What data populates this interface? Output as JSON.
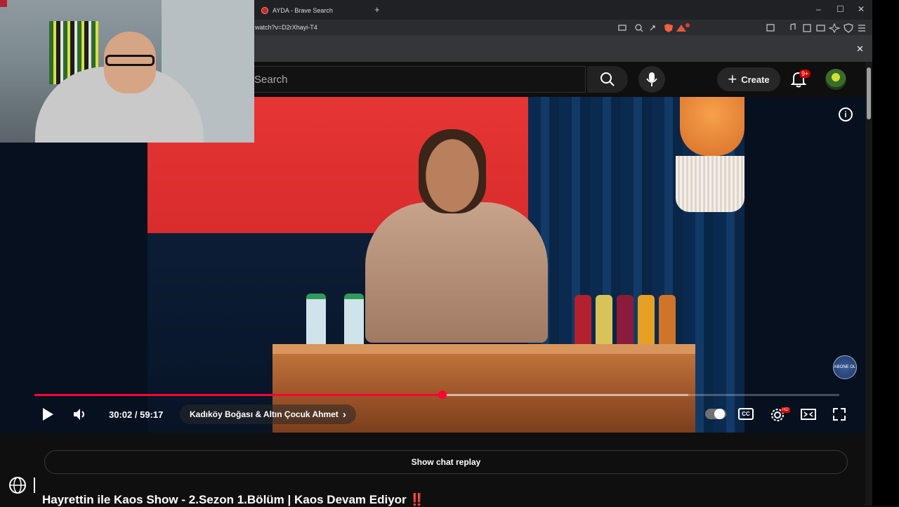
{
  "browser": {
    "tab_title": "AYDA - Brave Search",
    "new_tab_label": "+",
    "url": "watch?v=D2rXhayi-T4",
    "window_controls": [
      "–",
      "☐",
      "✕"
    ],
    "infobar_close": "✕"
  },
  "header": {
    "search_placeholder": "Search",
    "create_label": "Create",
    "notification_badge": "9+"
  },
  "video": {
    "info_icon": "i",
    "subscribe_badge": "ABONE OL"
  },
  "player": {
    "time": "30:02 / 59:17",
    "chapter_title": "Kadıköy Boğası & Altın Çocuk Ahmet",
    "chapter_chevron": "›",
    "cc_label": "CC",
    "hd_badge": "HD",
    "progress_fraction": 0.507
  },
  "below": {
    "show_chat_label": "Show chat replay",
    "video_title": "Hayrettin ile Kaos Show - 2.Sezon 1.Bölüm | Kaos Devam Ediyor ‼️"
  },
  "colors": {
    "accent": "#ff0033",
    "background": "#0f0f0f",
    "badge": "#cc0000"
  }
}
